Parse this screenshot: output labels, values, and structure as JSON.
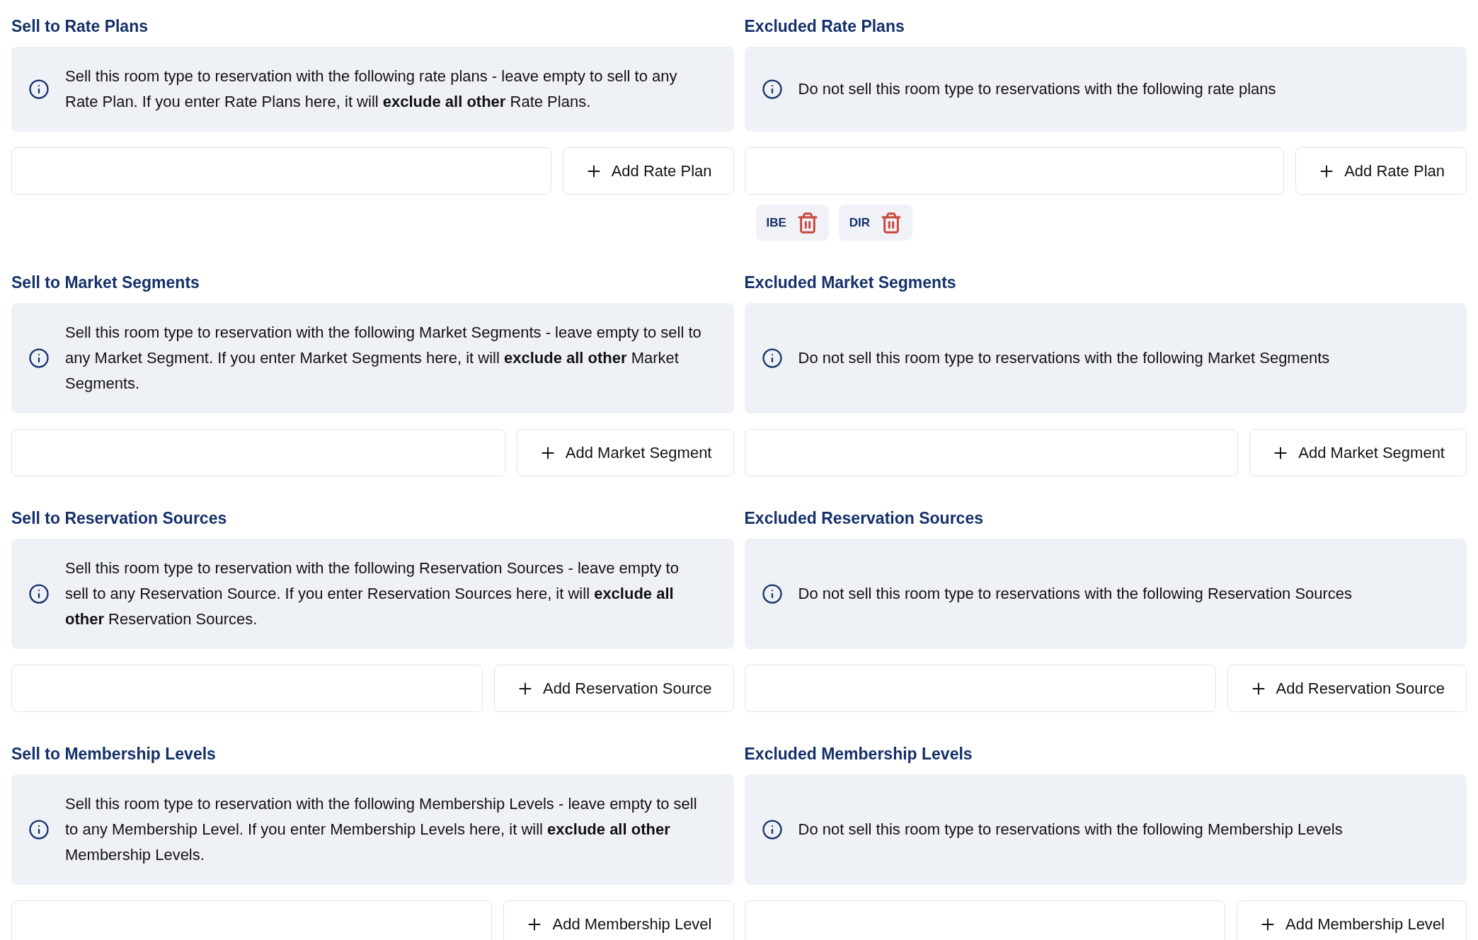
{
  "sections": [
    {
      "sell": {
        "title": "Sell to Rate Plans",
        "info": "Sell this room type to reservation with the following rate plans - leave empty to sell to any Rate Plan. If you enter Rate Plans here, it will **exclude all other** Rate Plans.",
        "button": "Add Rate Plan"
      },
      "excluded": {
        "title": "Excluded Rate Plans",
        "info": "Do not sell this room type to reservations with the following rate plans",
        "button": "Add Rate Plan",
        "tags": [
          {
            "label": "IBE"
          },
          {
            "label": "DIR"
          }
        ]
      }
    },
    {
      "sell": {
        "title": "Sell to Market Segments",
        "info": "Sell this room type to reservation with the following Market Segments - leave empty to sell to any Market Segment. If you enter Market Segments here, it will **exclude all other** Market Segments.",
        "button": "Add Market Segment"
      },
      "excluded": {
        "title": "Excluded Market Segments",
        "info": "Do not sell this room type to reservations with the following Market Segments",
        "button": "Add Market Segment"
      }
    },
    {
      "sell": {
        "title": "Sell to Reservation Sources",
        "info": "Sell this room type to reservation with the following Reservation Sources - leave empty to sell to any Reservation Source. If you enter Reservation Sources here, it will **exclude all other** Reservation Sources.",
        "button": "Add Reservation Source"
      },
      "excluded": {
        "title": "Excluded Reservation Sources",
        "info": "Do not sell this room type to reservations with the following Reservation Sources",
        "button": "Add Reservation Source"
      }
    },
    {
      "sell": {
        "title": "Sell to Membership Levels",
        "info": "Sell this room type to reservation with the following Membership Levels - leave empty to sell to any Membership Level. If you enter Membership Levels here, it will **exclude all other** Membership Levels.",
        "button": "Add Membership Level"
      },
      "excluded": {
        "title": "Excluded Membership Levels",
        "info": "Do not sell this room type to reservations with the following Membership Levels",
        "button": "Add Membership Level"
      }
    }
  ]
}
